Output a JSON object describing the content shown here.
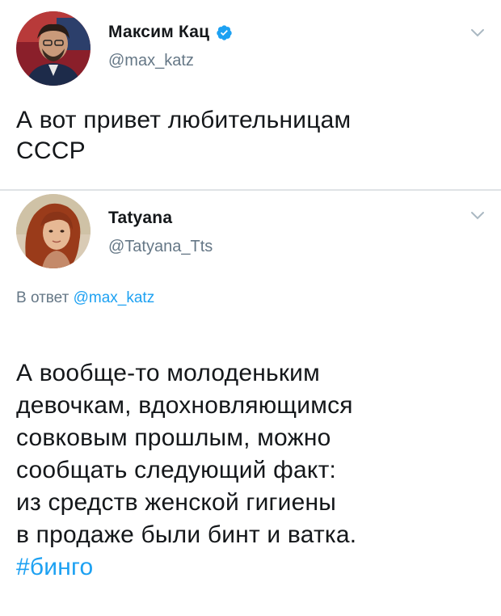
{
  "tweets": [
    {
      "display_name": "Максим Кац",
      "verified": true,
      "handle": "@max_katz",
      "text": "А вот привет любительницам\nСССР"
    },
    {
      "display_name": "Tatyana",
      "verified": false,
      "handle": "@Tatyana_Tts",
      "reply_prefix": "В ответ ",
      "reply_handle": "@max_katz",
      "text": "А вообще-то молоденьким\nдевочкам, вдохновляющимся\nсовковым прошлым, можно\nсообщать следующий факт:\nиз средств женской гигиены\nв продаже были бинт и ватка.",
      "hashtag": "#бинго"
    }
  ],
  "colors": {
    "text": "#14171a",
    "secondary": "#657786",
    "link": "#1da1f2",
    "divider": "#dfe3e6"
  },
  "icons": {
    "verified": "verified-badge-icon",
    "menu": "chevron-down-icon"
  }
}
